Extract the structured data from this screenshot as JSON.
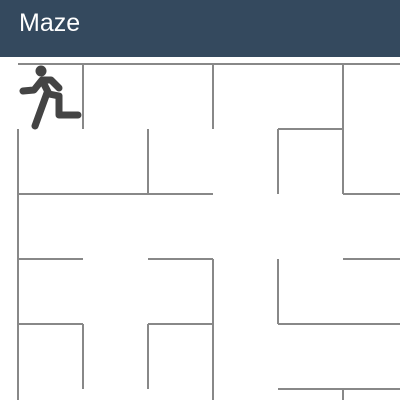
{
  "header": {
    "title": "Maze",
    "background": "#34495e"
  },
  "maze": {
    "wall_color": "#888888",
    "player_icon": "running-person-icon",
    "player_cell": [
      0,
      0
    ],
    "walls_grid": [
      [
        0,
        0,
        6.2,
        0
      ],
      [
        1,
        0,
        1,
        1
      ],
      [
        3,
        0,
        3,
        1
      ],
      [
        5,
        0,
        5,
        2
      ],
      [
        0,
        1,
        0,
        5.2
      ],
      [
        2,
        1,
        2,
        2
      ],
      [
        4,
        1,
        5,
        1
      ],
      [
        4,
        1,
        4,
        2
      ],
      [
        0,
        2,
        3,
        2
      ],
      [
        5,
        2,
        6.2,
        2
      ],
      [
        0,
        3,
        1,
        3
      ],
      [
        2,
        3,
        3,
        3
      ],
      [
        5,
        3,
        6.2,
        3
      ],
      [
        3,
        3,
        3,
        5.2
      ],
      [
        4,
        3,
        4,
        4
      ],
      [
        0,
        4,
        1,
        4
      ],
      [
        2,
        4,
        3,
        4
      ],
      [
        4,
        4,
        6.2,
        4
      ],
      [
        1,
        4,
        1,
        5
      ],
      [
        2,
        4,
        2,
        5
      ],
      [
        4,
        5,
        6.2,
        5
      ],
      [
        5,
        5,
        5,
        5.2
      ]
    ]
  }
}
